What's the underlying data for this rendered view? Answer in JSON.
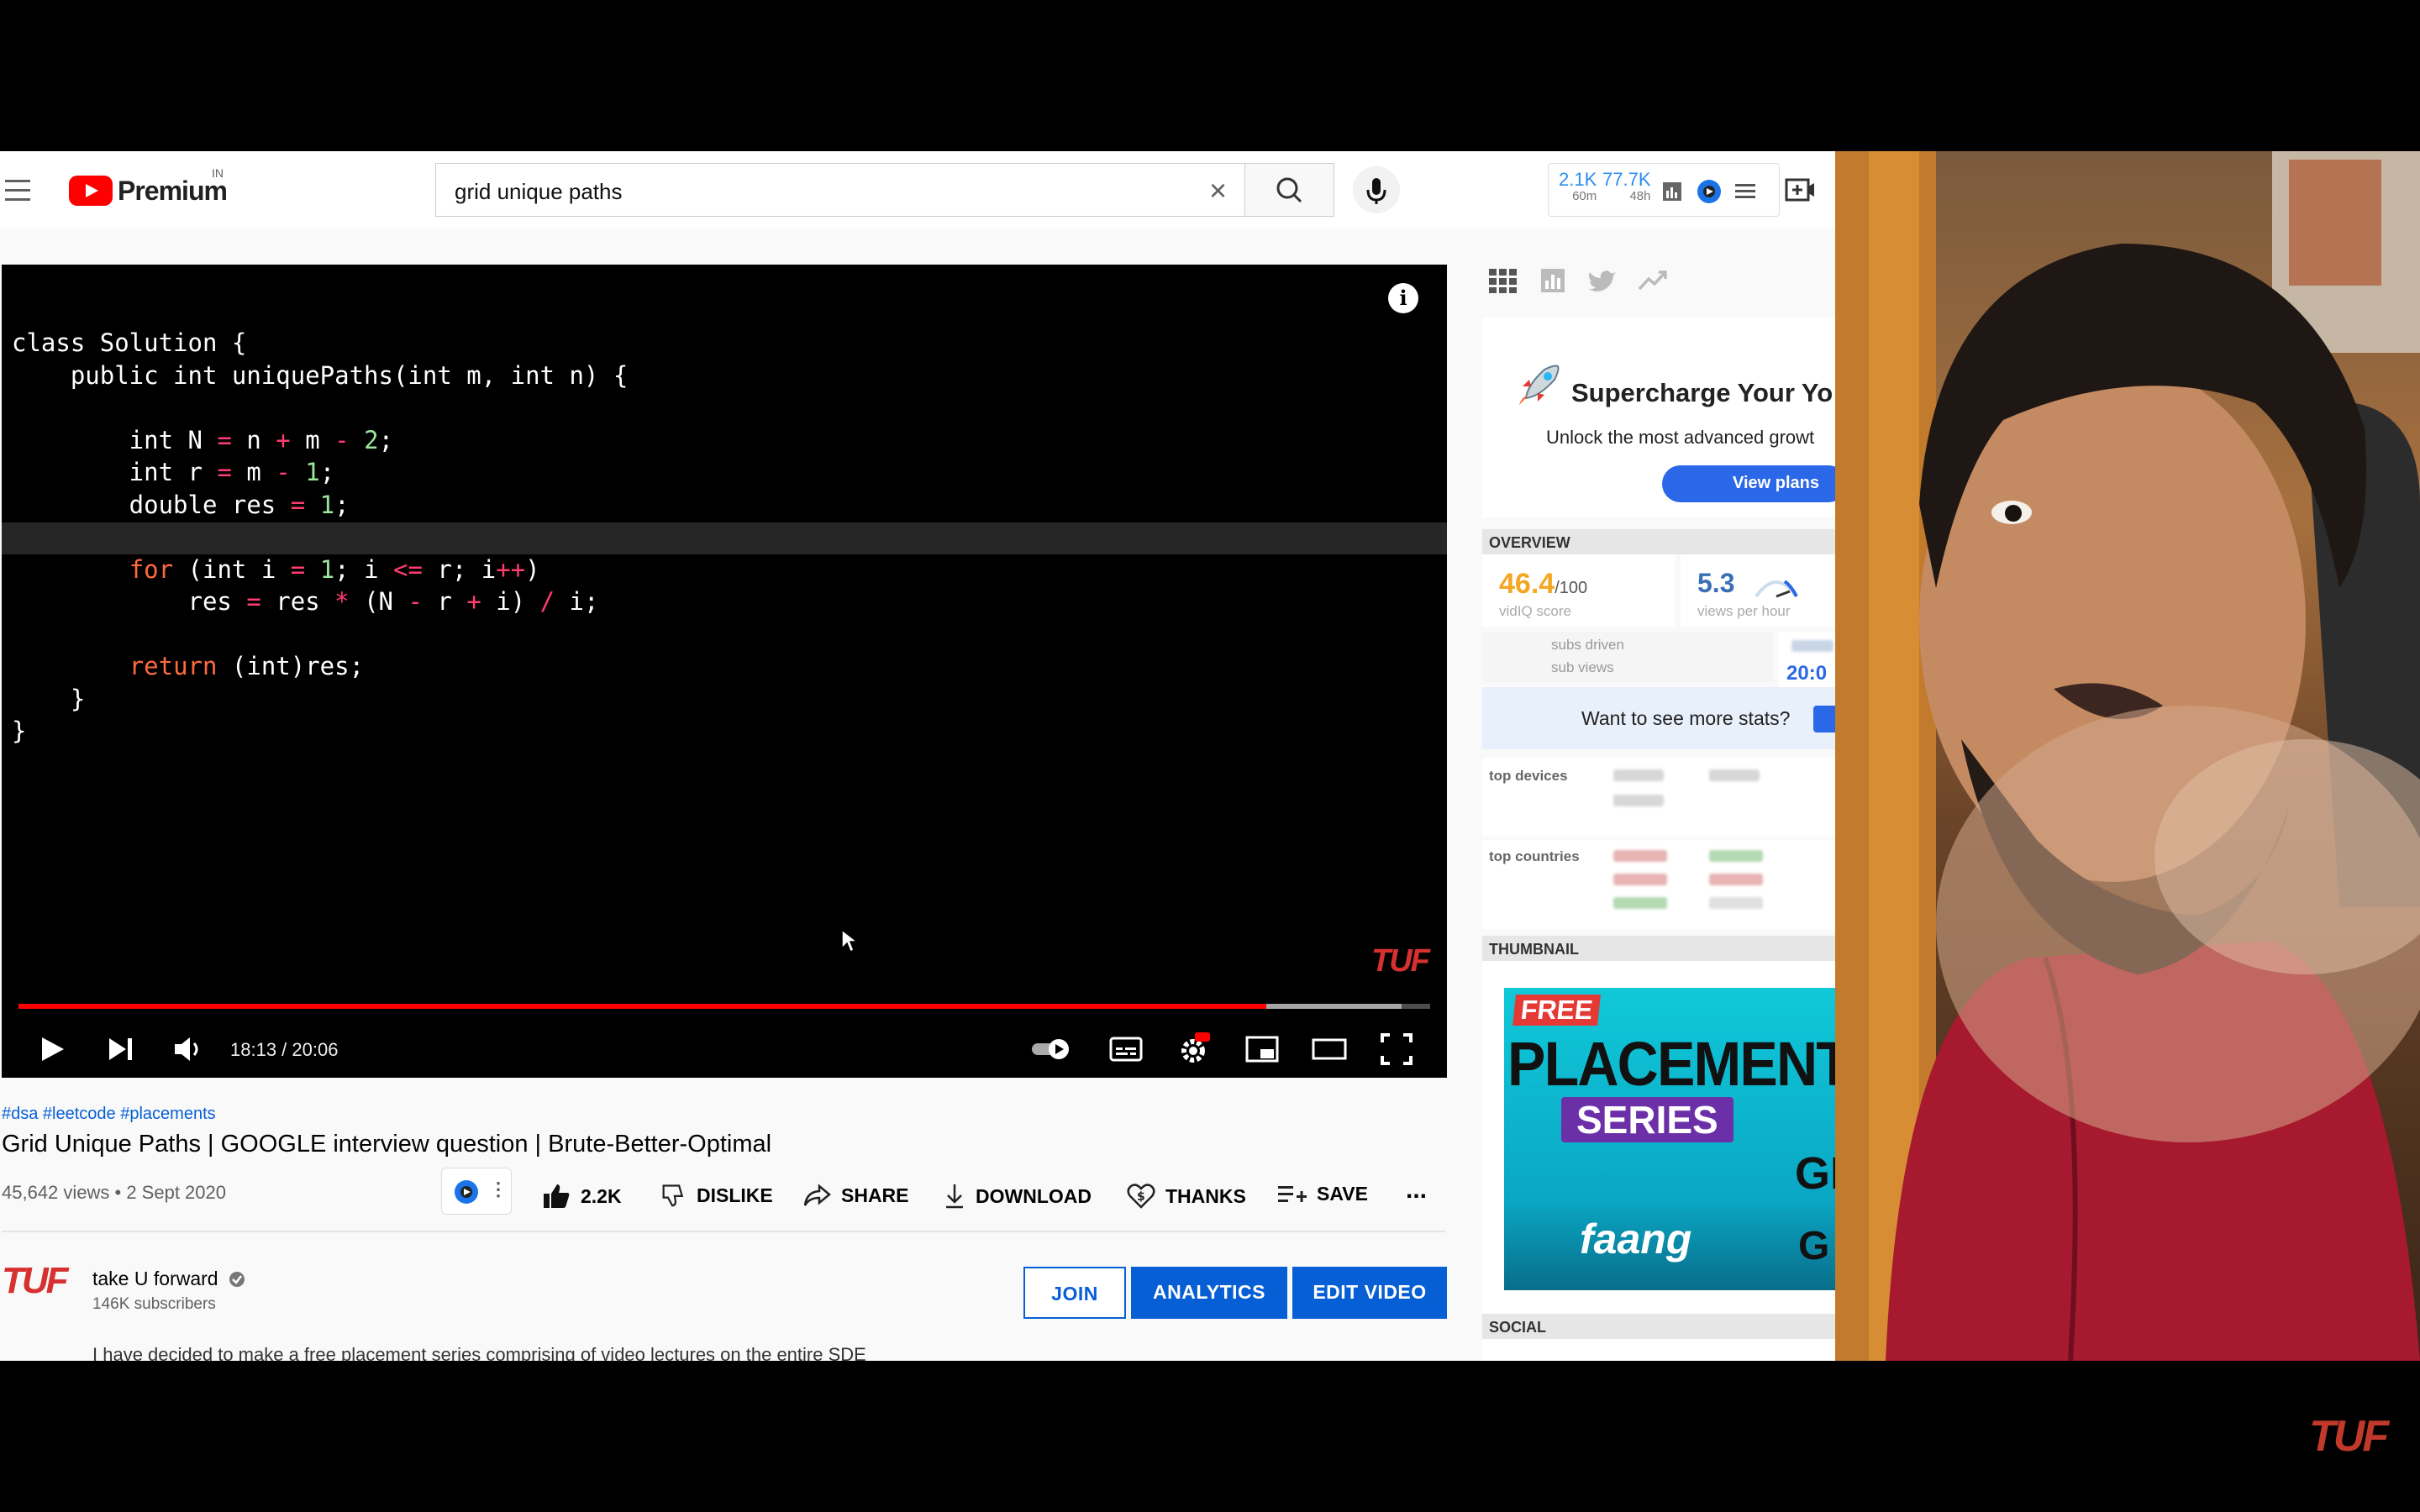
{
  "masthead": {
    "logo_text": "Premium",
    "region": "IN",
    "search_value": "grid unique paths",
    "vidiq_stats": [
      {
        "value": "2.1K",
        "label": "60m"
      },
      {
        "value": "77.7K",
        "label": "48h"
      }
    ]
  },
  "player": {
    "code_lines": [
      "class Solution {",
      "    public int uniquePaths(int m, int n) {",
      "",
      "        int N = n + m - 2;",
      "        int r = m - 1;",
      "        double res = 1;",
      "",
      "        for (int i = 1; i <= r; i++)",
      "            res = res * (N - r + i) / i;",
      "",
      "        return (int)res;",
      "    }",
      "}"
    ],
    "watermark": "TUF",
    "time": "18:13 / 20:06",
    "progress_fraction": 0.884,
    "buffered_fraction": 0.98,
    "info_icon": "info-icon"
  },
  "video": {
    "tags": "#dsa #leetcode #placements",
    "title": "Grid Unique Paths | GOOGLE interview question | Brute-Better-Optimal",
    "meta": "45,642 views • 2 Sept 2020",
    "like_count": "2.2K",
    "dislike_label": "DISLIKE",
    "share_label": "SHARE",
    "download_label": "DOWNLOAD",
    "thanks_label": "THANKS",
    "save_label": "SAVE",
    "more_label": "..."
  },
  "channel": {
    "logo_text": "TUF",
    "name": "take U forward",
    "subscribers": "146K subscribers",
    "join_label": "JOIN",
    "analytics_label": "ANALYTICS",
    "edit_label": "EDIT VIDEO",
    "description": "I have decided to make a free placement series comprising of video lectures on the entire SDE"
  },
  "sidebar": {
    "promo_title": "Supercharge Your Yo",
    "promo_sub": "Unlock the most advanced growt",
    "promo_button": "View plans",
    "overview_header": "OVERVIEW",
    "score_value": "46.4",
    "score_suffix": "/100",
    "score_label": "vidIQ score",
    "vph_value": "5.3",
    "vph_label": "views per hour",
    "subs_driven": "subs driven",
    "sub_views": "sub views",
    "right_value": "20:0",
    "more_stats": "Want to see more stats?",
    "top_devices": "top devices",
    "top_countries": "top countries",
    "thumb_header": "THUMBNAIL",
    "thumb_free": "FREE",
    "thumb_placement": "PLACEMENT",
    "thumb_series": "SERIES",
    "thumb_faang": "faang",
    "thumb_g": "GI",
    "thumb_g2": "G",
    "social_header": "SOCIAL"
  },
  "corner_watermark": "TUF"
}
